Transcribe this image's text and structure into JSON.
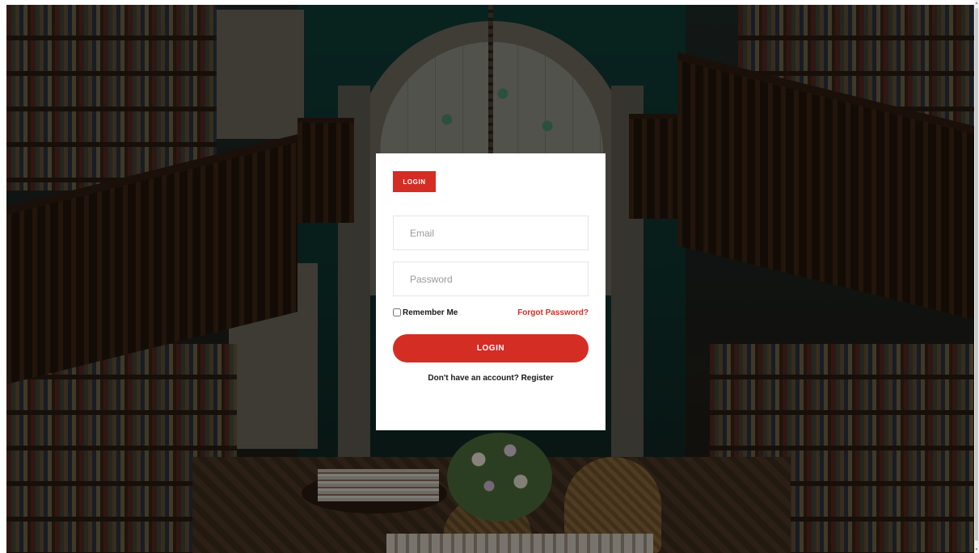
{
  "login_form": {
    "tab_label": "LOGIN",
    "email": {
      "value": "",
      "placeholder": "Email"
    },
    "password": {
      "value": "",
      "placeholder": "Password"
    },
    "remember_label": "Remember Me",
    "remember_checked": false,
    "forgot_label": "Forgot Password?",
    "submit_label": "LOGIN",
    "register_prompt": "Don't have an account?",
    "register_label": "Register"
  },
  "colors": {
    "accent": "#d42d24",
    "card_background": "#ffffff",
    "text": "#1a1a1a"
  },
  "scrollbar": {
    "up_icon": "chevron-up-icon",
    "down_icon": "chevron-down-icon"
  }
}
